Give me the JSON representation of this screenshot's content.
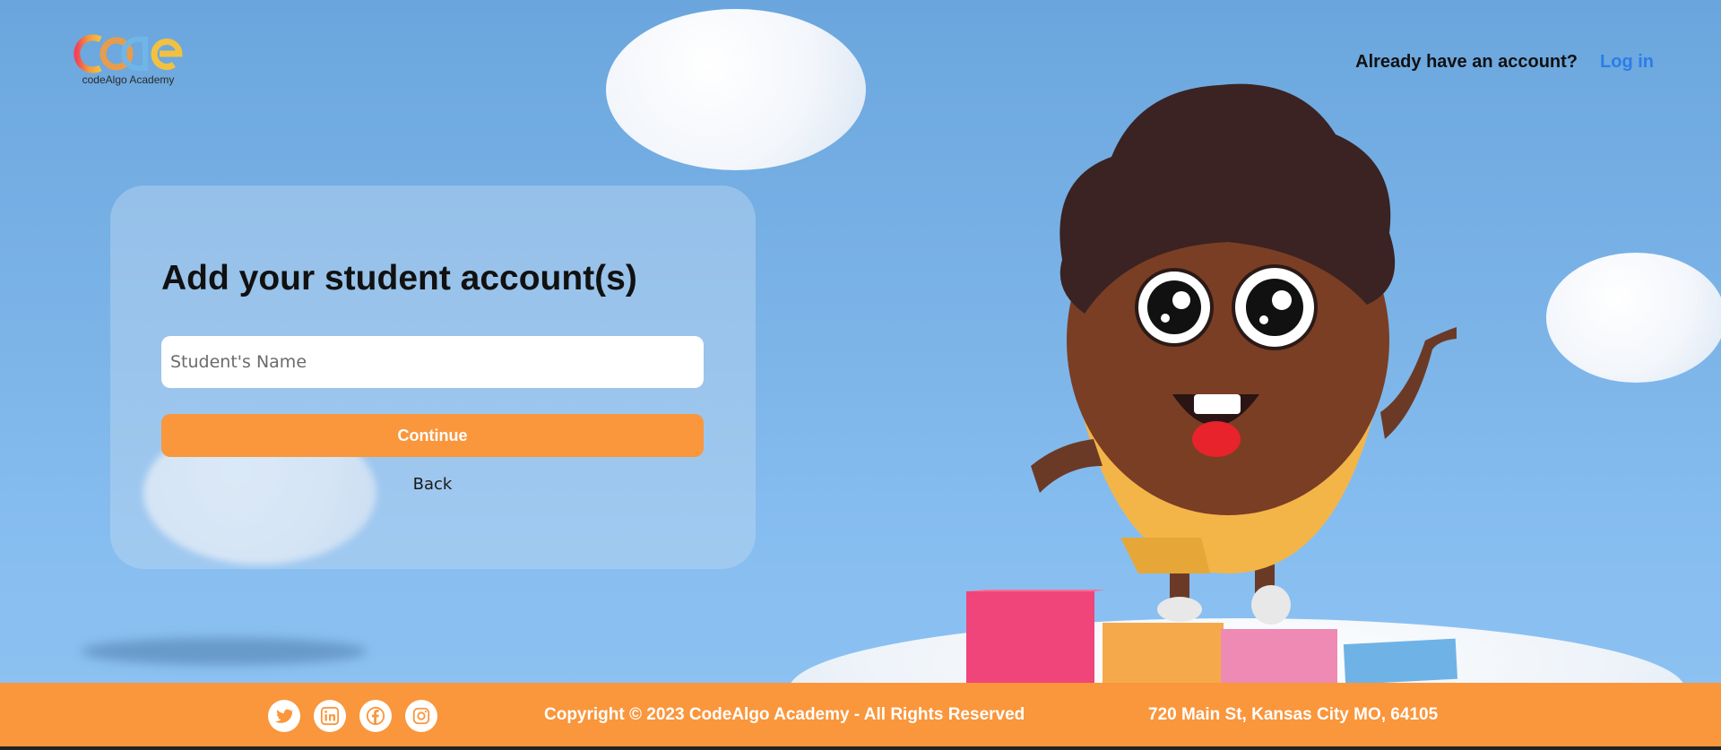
{
  "header": {
    "logo_text": "codeAlgo Academy",
    "account_prompt": "Already have an account?",
    "login_label": "Log in"
  },
  "card": {
    "title": "Add your student account(s)",
    "name_placeholder": "Student's Name",
    "name_value": "",
    "continue_label": "Continue",
    "back_label": "Back"
  },
  "footer": {
    "socials": [
      "twitter-icon",
      "linkedin-icon",
      "facebook-icon",
      "instagram-icon"
    ],
    "copyright": "Copyright © 2023 CodeAlgo Academy - All Rights Reserved",
    "address": "720 Main St, Kansas City MO, 64105"
  },
  "colors": {
    "accent": "#fa963c",
    "link": "#2b7de9",
    "sky": "#7cb4e8"
  }
}
